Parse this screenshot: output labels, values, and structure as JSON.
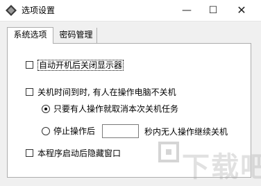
{
  "window": {
    "title": "选项设置",
    "minimize": "—",
    "maximize": "☐",
    "close": "✕"
  },
  "tabs": [
    {
      "label": "系统选项",
      "active": true
    },
    {
      "label": "密码管理",
      "active": false
    }
  ],
  "options": {
    "auto_start_close_display": {
      "label": "自动开机后关闭显示器",
      "checked": false
    },
    "shutdown_time_check": {
      "label": "关机时间到时, 有人在操作电脑不关机",
      "checked": false
    },
    "radio_cancel": {
      "label": "只要有人操作就取消本次关机任务",
      "selected": true
    },
    "radio_stop": {
      "label": "停止操作后",
      "selected": false
    },
    "seconds_value": "",
    "radio_stop_suffix": "秒内无人操作继续关机",
    "hide_window_on_start": {
      "label": "本程序启动后隐藏窗口",
      "checked": false
    }
  },
  "watermark": {
    "text": "下载吧"
  },
  "colors": {
    "window_bg": "#f0f0f0",
    "panel_bg": "#ffffff",
    "border": "#adadad"
  }
}
